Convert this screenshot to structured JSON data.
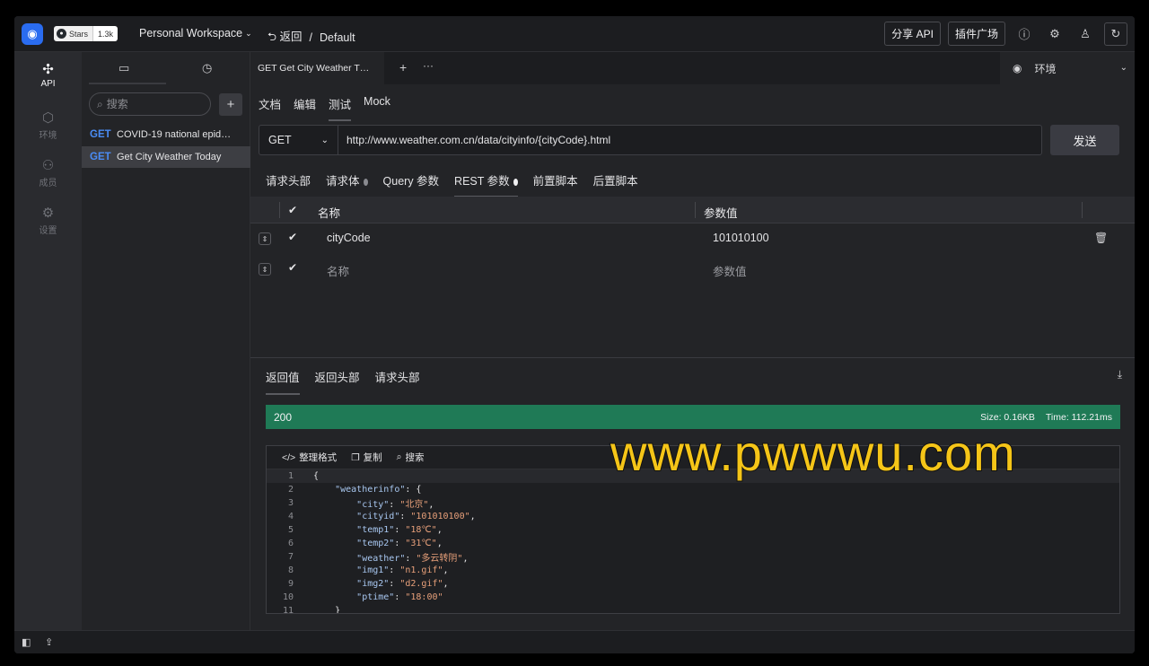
{
  "topbar": {
    "github_badge_label": "Stars",
    "github_badge_count": "1.3k",
    "workspace": "Personal Workspace",
    "back_label": "返回",
    "separator": "/",
    "breadcrumb_current": "Default",
    "share_api": "分享 API",
    "plugin_market": "插件广场"
  },
  "rail": {
    "items": [
      {
        "label": "API",
        "icon": "api-icon"
      },
      {
        "label": "环境",
        "icon": "cube-icon"
      },
      {
        "label": "成员",
        "icon": "members-icon"
      },
      {
        "label": "设置",
        "icon": "settings-icon"
      }
    ]
  },
  "sidebar": {
    "search_placeholder": "搜索",
    "apis": [
      {
        "method": "GET",
        "name": "COVID-19 national epid…"
      },
      {
        "method": "GET",
        "name": "Get City Weather Today"
      }
    ]
  },
  "tabs": {
    "active_tab": "GET  Get City Weather T…",
    "env_label": "环境"
  },
  "subtabs": [
    "文档",
    "编辑",
    "测试",
    "Mock"
  ],
  "request": {
    "method": "GET",
    "url": "http://www.weather.com.cn/data/cityinfo/{cityCode}.html",
    "send": "发送"
  },
  "param_tabs": [
    "请求头部",
    "请求体",
    "Query 参数",
    "REST 参数",
    "前置脚本",
    "后置脚本"
  ],
  "param_table": {
    "col_name": "名称",
    "col_value": "参数值",
    "rows": [
      {
        "name": "cityCode",
        "value": "101010100"
      }
    ],
    "placeholder_name": "名称",
    "placeholder_value": "参数值"
  },
  "response": {
    "tabs": [
      "返回值",
      "返回头部",
      "请求头部"
    ],
    "status": "200",
    "size": "Size: 0.16KB",
    "time": "Time: 112.21ms",
    "tools": [
      "整理格式",
      "复制",
      "搜索"
    ],
    "line_numbers": [
      "1",
      "2",
      "3",
      "4",
      "5",
      "6",
      "7",
      "8",
      "9",
      "10",
      "11"
    ],
    "lines": [
      "{",
      "    \"weatherinfo\": {",
      "        \"city\": \"北京\",",
      "        \"cityid\": \"101010100\",",
      "        \"temp1\": \"18℃\",",
      "        \"temp2\": \"31℃\",",
      "        \"weather\": \"多云转阴\",",
      "        \"img1\": \"n1.gif\",",
      "        \"img2\": \"d2.gif\",",
      "        \"ptime\": \"18:00\"",
      "    }"
    ]
  },
  "watermark": "www.pwwwu.com",
  "colors": {
    "status_ok": "#1f7a56",
    "method_get": "#4a8cf5",
    "watermark": "#f5c518"
  }
}
